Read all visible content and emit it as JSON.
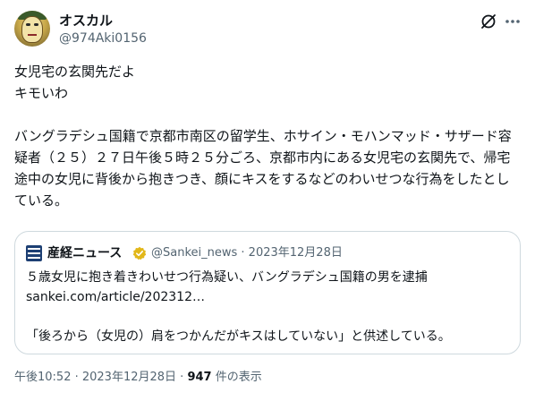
{
  "author": {
    "display_name": "オスカル",
    "handle": "@974Aki0156"
  },
  "header_icons": [
    "grok-icon",
    "more-icon"
  ],
  "post": {
    "line1": "女児宅の玄関先だよ",
    "line2": "キモいわ",
    "paragraph": "バングラデシュ国籍で京都市南区の留学生、ホサイン・モハンマッド・サザード容疑者（２５）２７日午後５時２５分ごろ、京都市内にある女児宅の玄関先で、帰宅途中の女児に背後から抱きつき、顔にキスをするなどのわいせつな行為をしたとしている。"
  },
  "quote": {
    "name": "産経ニュース",
    "handle_date": "@Sankei_news · 2023年12月28日",
    "headline": "５歳女児に抱き着きわいせつ行為疑い、バングラデシュ国籍の男を逮捕",
    "link": "sankei.com/article/202312…",
    "excerpt": "「後ろから（女児の）肩をつかんだがキスはしていない」と供述している。",
    "verified_color": "#e2b719"
  },
  "meta": {
    "time_date": "午後10:52 · 2023年12月28日 · ",
    "views_count": "947",
    "views_label": " 件の表示"
  },
  "colors": {
    "text": "#0f1419",
    "secondary": "#536471",
    "border": "#cfd9de"
  }
}
